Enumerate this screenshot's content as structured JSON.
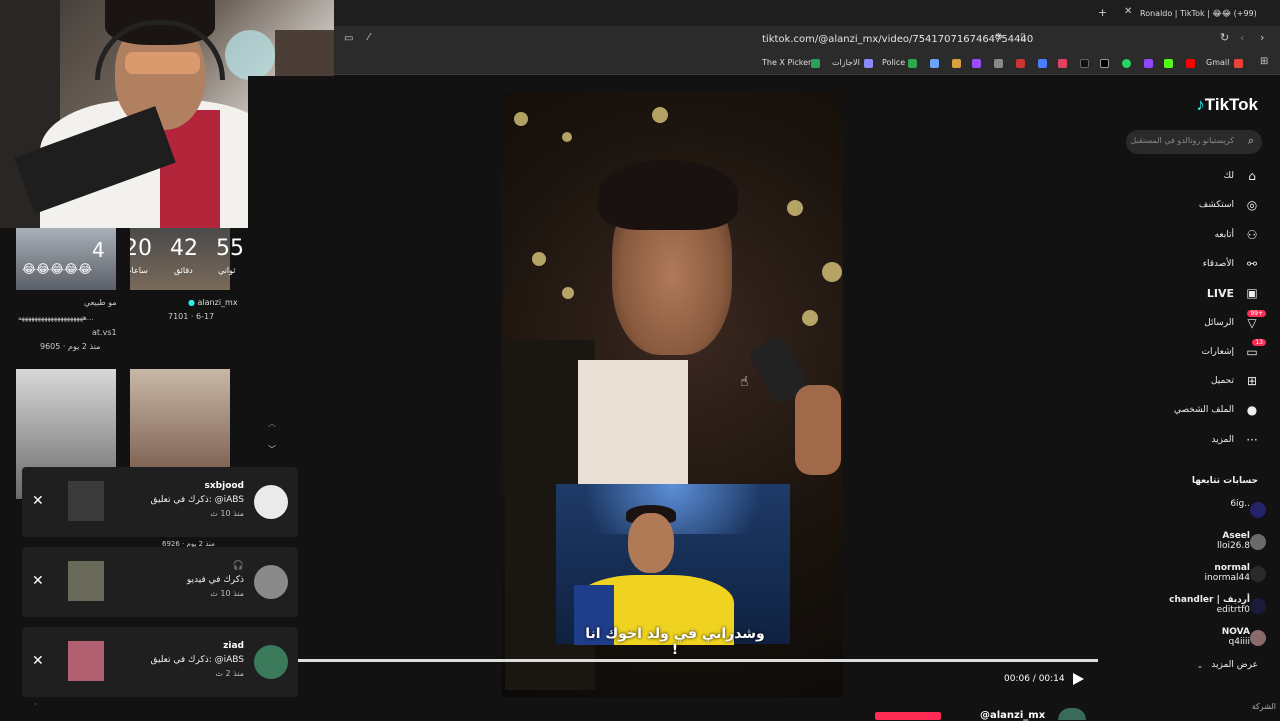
{
  "browser": {
    "tab_title": "Ronaldo | TikTok | 😂😂 (+99)",
    "url": "tiktok.com/@alanzi_mx/video/7541707167464754440",
    "bookmarks": [
      "The X Picker",
      "الاجازات",
      "Police",
      "Gmail"
    ]
  },
  "tiktok": {
    "logo": "TikTok",
    "search_placeholder": "كريستيانو رونالدو في المستقبل",
    "nav": [
      {
        "label": "لك",
        "icon": "home-icon"
      },
      {
        "label": "استكشف",
        "icon": "compass-icon"
      },
      {
        "label": "أتابعه",
        "icon": "user-follow-icon"
      },
      {
        "label": "الأصدقاء",
        "icon": "friends-icon"
      },
      {
        "label": "LIVE",
        "icon": "live-icon"
      },
      {
        "label": "الرسائل",
        "icon": "messages-icon",
        "badge": "99+"
      },
      {
        "label": "إشعارات",
        "icon": "bell-icon",
        "badge": "13"
      },
      {
        "label": "تحميل",
        "icon": "upload-icon"
      },
      {
        "label": "الملف الشخصي",
        "icon": "profile-icon"
      },
      {
        "label": "المزيد",
        "icon": "more-icon"
      }
    ],
    "following_header": "حسابات تتابعها",
    "following": [
      {
        "name": "",
        "handle": "6ig.."
      },
      {
        "name": "Aseel",
        "handle": "lloi26.8"
      },
      {
        "name": "normal",
        "handle": "inormal44"
      },
      {
        "name": "chandler | أرديف",
        "handle": "editrtf0"
      },
      {
        "name": "NOVA",
        "handle": "q4iiii"
      }
    ],
    "see_more": "عرض المزيد",
    "footer_company": "الشركة",
    "video": {
      "subtitle": "وشدراني في ولد اخوك انا !",
      "time": "00:06 / 00:14",
      "progress": 1.0,
      "author_handle": "@alanzi_mx"
    }
  },
  "left_feed": {
    "countdown": {
      "seconds": "55",
      "minutes": "42",
      "hours": "20",
      "days": "4",
      "seconds_label": "ثواني",
      "minutes_label": "دقائق",
      "hours_label": "ساعات"
    },
    "user1": "alanzi_mx",
    "user1_stats": "7101 · 6-17",
    "user2_caption": "مو طبيعي",
    "user2_text": "ههههههههههههههههههههه...",
    "user2_handle": "at.vs1",
    "user2_stats": "9605 · منذ 2 يوم",
    "partial_stats": "6926 · منذ 2 يوم"
  },
  "notifications": [
    {
      "name": "sxbjood",
      "message": "ذكرك في تعليق: @iABS",
      "time": "منذ 10 ث"
    },
    {
      "name": "🎧",
      "message": "ذكرك في فيديو",
      "time": "منذ 10 ث"
    },
    {
      "name": "ziad",
      "message": "ذكرك في تعليق: @iABS",
      "time": "منذ 2 ث"
    }
  ]
}
